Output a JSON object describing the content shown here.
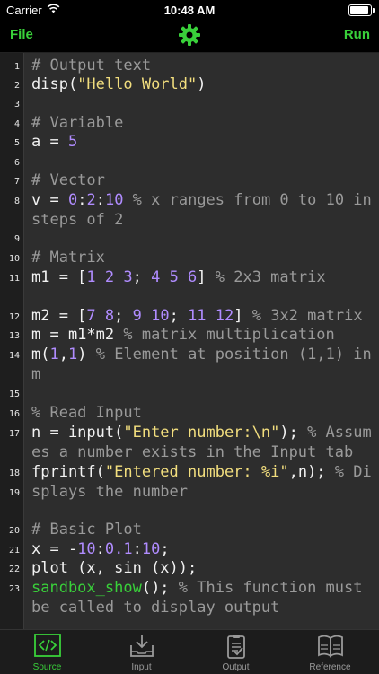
{
  "status_bar": {
    "carrier": "Carrier",
    "time": "10:48 AM"
  },
  "navbar": {
    "file_label": "File",
    "run_label": "Run",
    "settings_icon": "gear-icon"
  },
  "colors": {
    "accent": "#39d03a",
    "comment": "#9a9a9a",
    "number": "#b08cff",
    "string": "#f2de7e",
    "editor_bg": "#2d2d2d",
    "gutter_bg": "#1e1e1e"
  },
  "editor": {
    "lines": [
      {
        "n": "1",
        "segs": [
          {
            "t": "# Output text",
            "c": "cm"
          }
        ]
      },
      {
        "n": "2",
        "segs": [
          {
            "t": "disp(",
            "c": ""
          },
          {
            "t": "\"Hello World\"",
            "c": "str"
          },
          {
            "t": ")",
            "c": ""
          }
        ]
      },
      {
        "n": "3",
        "segs": []
      },
      {
        "n": "4",
        "segs": [
          {
            "t": "# Variable",
            "c": "cm"
          }
        ]
      },
      {
        "n": "5",
        "segs": [
          {
            "t": "a = ",
            "c": ""
          },
          {
            "t": "5",
            "c": "num"
          }
        ]
      },
      {
        "n": "6",
        "segs": []
      },
      {
        "n": "7",
        "segs": [
          {
            "t": "# Vector",
            "c": "cm"
          }
        ]
      },
      {
        "n": "8",
        "segs": [
          {
            "t": "v = ",
            "c": ""
          },
          {
            "t": "0",
            "c": "num"
          },
          {
            "t": ":",
            "c": ""
          },
          {
            "t": "2",
            "c": "num"
          },
          {
            "t": ":",
            "c": ""
          },
          {
            "t": "10",
            "c": "num"
          },
          {
            "t": " % x ranges from 0 to 10 in steps of 2",
            "c": "cm"
          }
        ]
      },
      {
        "n": "9",
        "segs": []
      },
      {
        "n": "10",
        "segs": [
          {
            "t": "# Matrix",
            "c": "cm"
          }
        ]
      },
      {
        "n": "11",
        "segs": [
          {
            "t": "m1 = [",
            "c": ""
          },
          {
            "t": "1 2 3",
            "c": "num"
          },
          {
            "t": "; ",
            "c": ""
          },
          {
            "t": "4 5 6",
            "c": "num"
          },
          {
            "t": "]",
            "c": ""
          },
          {
            "t": " % 2x3 matrix",
            "c": "cm"
          }
        ]
      },
      {
        "n": "12",
        "segs": [
          {
            "t": "m2 = [",
            "c": ""
          },
          {
            "t": "7 8",
            "c": "num"
          },
          {
            "t": "; ",
            "c": ""
          },
          {
            "t": "9 10",
            "c": "num"
          },
          {
            "t": "; ",
            "c": ""
          },
          {
            "t": "11 12",
            "c": "num"
          },
          {
            "t": "]",
            "c": ""
          },
          {
            "t": " % 3x2 matrix",
            "c": "cm"
          }
        ]
      },
      {
        "n": "13",
        "segs": [
          {
            "t": "m = m1*m2",
            "c": ""
          },
          {
            "t": " % matrix multiplication",
            "c": "cm"
          }
        ]
      },
      {
        "n": "14",
        "segs": [
          {
            "t": "m(",
            "c": ""
          },
          {
            "t": "1",
            "c": "num"
          },
          {
            "t": ",",
            "c": ""
          },
          {
            "t": "1",
            "c": "num"
          },
          {
            "t": ")",
            "c": ""
          },
          {
            "t": " % Element at position (1,1) in m",
            "c": "cm"
          }
        ]
      },
      {
        "n": "15",
        "segs": []
      },
      {
        "n": "16",
        "segs": [
          {
            "t": "% Read Input",
            "c": "cm"
          }
        ]
      },
      {
        "n": "17",
        "segs": [
          {
            "t": "n = input(",
            "c": ""
          },
          {
            "t": "\"Enter number:\\n\"",
            "c": "str"
          },
          {
            "t": ");",
            "c": ""
          },
          {
            "t": " % Assumes a number exists in the Input tab",
            "c": "cm"
          }
        ]
      },
      {
        "n": "18",
        "segs": [
          {
            "t": "fprintf(",
            "c": ""
          },
          {
            "t": "\"Entered number: %i\"",
            "c": "str"
          },
          {
            "t": ",n);",
            "c": ""
          },
          {
            "t": " % Displays the number",
            "c": "cm"
          }
        ]
      },
      {
        "n": "19",
        "segs": []
      },
      {
        "n": "20",
        "segs": [
          {
            "t": "# Basic Plot",
            "c": "cm"
          }
        ]
      },
      {
        "n": "21",
        "segs": [
          {
            "t": "x = -",
            "c": ""
          },
          {
            "t": "10",
            "c": "num"
          },
          {
            "t": ":",
            "c": ""
          },
          {
            "t": "0.1",
            "c": "num"
          },
          {
            "t": ":",
            "c": ""
          },
          {
            "t": "10",
            "c": "num"
          },
          {
            "t": ";",
            "c": ""
          }
        ]
      },
      {
        "n": "22",
        "segs": [
          {
            "t": "plot (x, sin (x));",
            "c": ""
          }
        ]
      },
      {
        "n": "23",
        "segs": [
          {
            "t": "sandbox_show",
            "c": "fn"
          },
          {
            "t": "();",
            "c": ""
          },
          {
            "t": " % This function must be called to display output",
            "c": "cm"
          }
        ]
      }
    ]
  },
  "tabbar": {
    "tabs": [
      {
        "label": "Source",
        "icon": "code-icon",
        "active": true
      },
      {
        "label": "Input",
        "icon": "download-tray-icon",
        "active": false
      },
      {
        "label": "Output",
        "icon": "clipboard-icon",
        "active": false
      },
      {
        "label": "Reference",
        "icon": "book-icon",
        "active": false
      }
    ]
  }
}
